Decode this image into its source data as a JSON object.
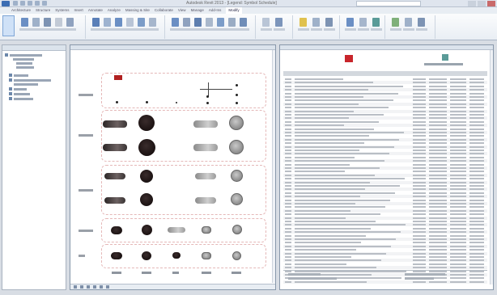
{
  "window": {
    "title": "Autodesk Revit 2013 - [Legend: Symbol Schedule]"
  },
  "ribbon": {
    "tabs": [
      "Architecture",
      "Structure",
      "Systems",
      "Insert",
      "Annotate",
      "Analyze",
      "Massing & Site",
      "Collaborate",
      "View",
      "Manage",
      "Add-Ins",
      "Modify"
    ],
    "active_tab": "Modify",
    "panels": [
      "Select",
      "Properties",
      "Clipboard",
      "Geometry",
      "Modify",
      "View",
      "Measure",
      "Create"
    ]
  },
  "colors": {
    "accent": "#3b6db3",
    "logo_red": "#c8252b",
    "logo_teal": "#5a9b98",
    "symbol_dark": "#1b1212",
    "legend_border": "#e5b8b8"
  }
}
